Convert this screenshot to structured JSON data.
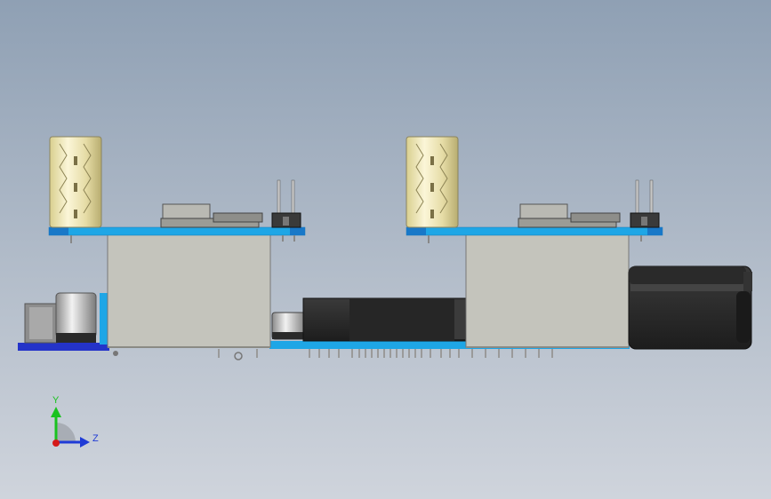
{
  "viewport": {
    "background_top": "#8fa0b4",
    "background_bottom": "#cfd4dc"
  },
  "axes": {
    "y_label": "Y",
    "z_label": "Z",
    "y_color": "#19c21f",
    "z_color": "#1f3bd6",
    "x_color": "#d41919"
  },
  "colors": {
    "board_cyan": "#1ea6e6",
    "board_blue": "#2433c9",
    "module_body": "#c4c4bc",
    "capacitor_gold": "#e9e2b3",
    "connector_dark": "#2a2a2a"
  }
}
